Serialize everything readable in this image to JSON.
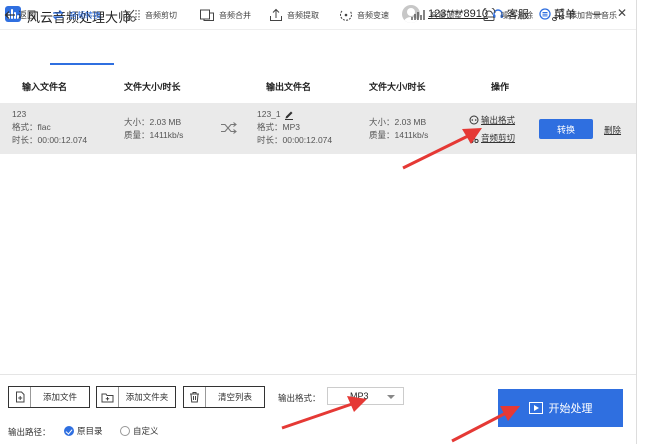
{
  "app": {
    "title": "风云音频处理大师",
    "username": "123****8910",
    "service_label": "客服",
    "menu_label": "菜单"
  },
  "window": {
    "minimize_glyph": "—",
    "close_glyph": "✕"
  },
  "toolbar": {
    "back_label": "返回",
    "tools": [
      {
        "label": "音频转换",
        "icon": "convert-icon"
      },
      {
        "label": "音频剪切",
        "icon": "scissors-icon"
      },
      {
        "label": "音频合并",
        "icon": "merge-icon"
      },
      {
        "label": "音频提取",
        "icon": "extract-icon"
      },
      {
        "label": "音频变速",
        "icon": "speed-icon"
      },
      {
        "label": "音量调整",
        "icon": "volume-icon"
      },
      {
        "label": "噪声消除",
        "icon": "noise-icon"
      },
      {
        "label": "添加背景音乐",
        "icon": "music-note-icon"
      }
    ]
  },
  "table": {
    "headers": {
      "input_name": "输入文件名",
      "input_size": "文件大小/时长",
      "output_name": "输出文件名",
      "output_size": "文件大小/时长",
      "operation": "操作"
    },
    "row": {
      "input_name": "123",
      "input_format": "格式：flac",
      "input_duration": "时长：00:00:12.074",
      "input_size": "大小：2.03 MB",
      "input_quality": "质量：1411kb/s",
      "output_name": "123_1",
      "output_format": "格式：MP3",
      "output_duration": "时长：00:00:12.074",
      "output_size": "大小：2.03 MB",
      "output_quality": "质量：1411kb/s",
      "op_format": "输出格式",
      "op_cut": "音频剪切",
      "convert": "转换",
      "delete": "删除"
    }
  },
  "bottom": {
    "add_file": "添加文件",
    "add_folder": "添加文件夹",
    "clear_list": "清空列表",
    "format_label": "输出格式：",
    "format_value": "MP3",
    "path_label": "输出路径：",
    "path_option_original": "原目录",
    "path_option_custom": "自定义",
    "start": "开始处理"
  },
  "colors": {
    "accent": "#2f6fe0",
    "row_bg": "#eaeaea",
    "arrow": "#e53935"
  }
}
